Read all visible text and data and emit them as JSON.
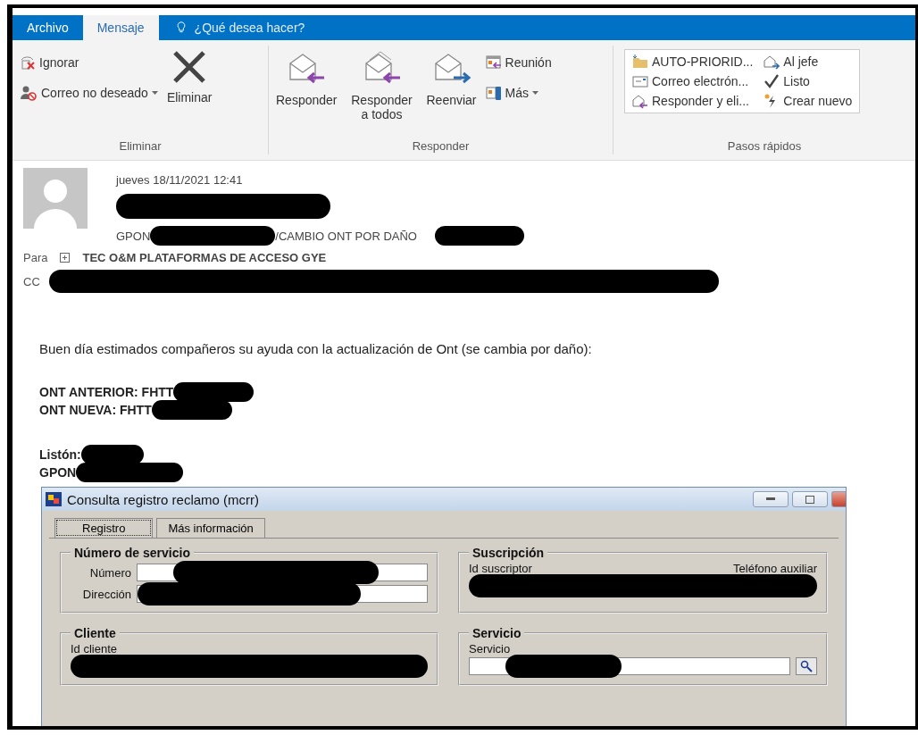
{
  "tabs": [
    {
      "label": "Archivo",
      "selected": false
    },
    {
      "label": "Mensaje",
      "selected": true
    }
  ],
  "tell_me": {
    "placeholder": "¿Qué desea hacer?"
  },
  "ribbon": {
    "delete_group": {
      "label": "Eliminar",
      "ignore": "Ignorar",
      "junk": "Correo no deseado",
      "delete": "Eliminar"
    },
    "respond_group": {
      "label": "Responder",
      "reply": "Responder",
      "reply_all": "Responder a todos",
      "forward": "Reenviar",
      "meeting": "Reunión",
      "more": "Más"
    },
    "quick_steps": {
      "label": "Pasos rápidos",
      "items": [
        "AUTO-PRIORID...",
        "Al jefe",
        "Correo electrón...",
        "Listo",
        "Responder y eli...",
        "Crear nuevo"
      ]
    }
  },
  "message": {
    "date": "jueves 18/11/2021 12:41",
    "subject_start": "GPON",
    "subject_middle": "/CAMBIO ONT POR DAÑO",
    "to_label": "Para",
    "to": "TEC O&M PLATAFORMAS DE ACCESO GYE",
    "cc_label": "CC"
  },
  "body": {
    "intro": "Buen día estimados compañeros su ayuda con la actualización de Ont (se cambia por daño):",
    "ont_old": "ONT ANTERIOR: FHTT",
    "ont_new": "ONT NUEVA: FHTT",
    "liston": "Listón:",
    "gpon": "GPON"
  },
  "legacy_window": {
    "title": "Consulta registro reclamo (mcrr)",
    "tabs": [
      {
        "label": "Registro",
        "selected": true
      },
      {
        "label": "Más información",
        "selected": false
      }
    ],
    "service_number": {
      "title": "Número de servicio",
      "number_label": "Número",
      "address_label": "Dirección"
    },
    "subscription": {
      "title": "Suscripción",
      "subscriber_label": "Id suscriptor",
      "phone_label": "Teléfono auxiliar"
    },
    "client": {
      "title": "Cliente",
      "client_label": "Id cliente"
    },
    "service": {
      "title": "Servicio",
      "service_label": "Servicio"
    }
  }
}
